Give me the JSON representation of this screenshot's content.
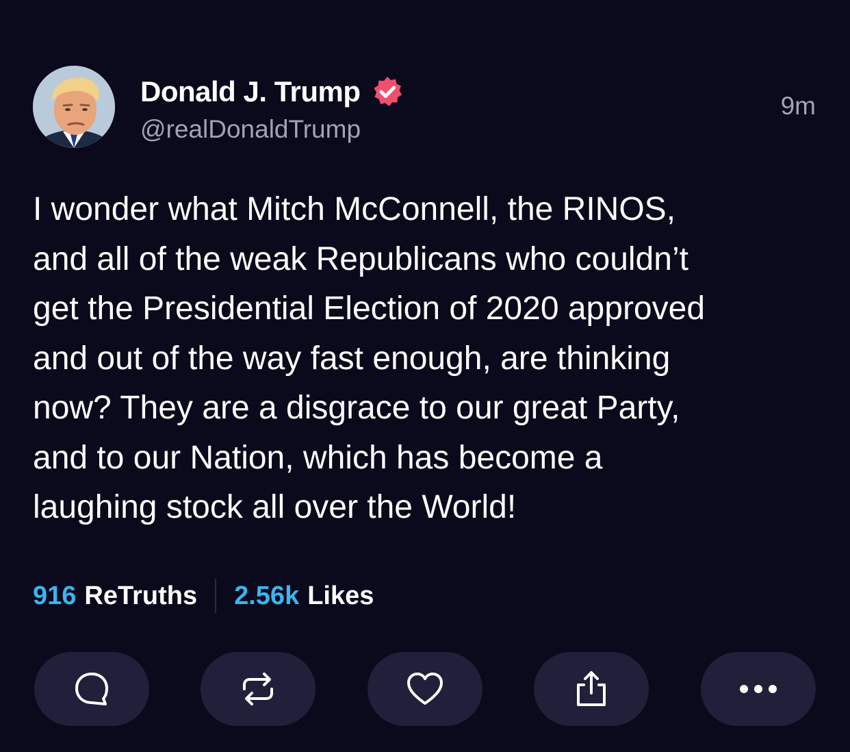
{
  "post": {
    "author": {
      "display_name": "Donald J. Trump",
      "handle": "@realDonaldTrump",
      "verified": true,
      "avatar_icon": "profile-photo"
    },
    "timestamp": "9m",
    "body_lines": [
      "I wonder what Mitch McConnell, the RINOS,",
      "and all of the weak Republicans who couldn’t",
      "get the Presidential Election of 2020 approved",
      "and out of the way fast enough, are thinking",
      "now? They are a disgrace to our great Party,",
      "and to our Nation, which has become a",
      "laughing stock all over the World!"
    ]
  },
  "stats": {
    "retruths_count": "916",
    "retruths_label": "ReTruths",
    "likes_count": "2.56k",
    "likes_label": "Likes"
  },
  "actions": [
    {
      "name": "reply",
      "icon": "comment-icon"
    },
    {
      "name": "retruth",
      "icon": "repost-icon"
    },
    {
      "name": "like",
      "icon": "heart-icon"
    },
    {
      "name": "share",
      "icon": "share-icon"
    },
    {
      "name": "more",
      "icon": "more-icon"
    }
  ],
  "colors": {
    "background": "#0a0a1c",
    "accent": "#3cb4f0",
    "verified": "#f0506e",
    "muted_text": "#a3a3b3",
    "button_bg": "#20203a"
  }
}
